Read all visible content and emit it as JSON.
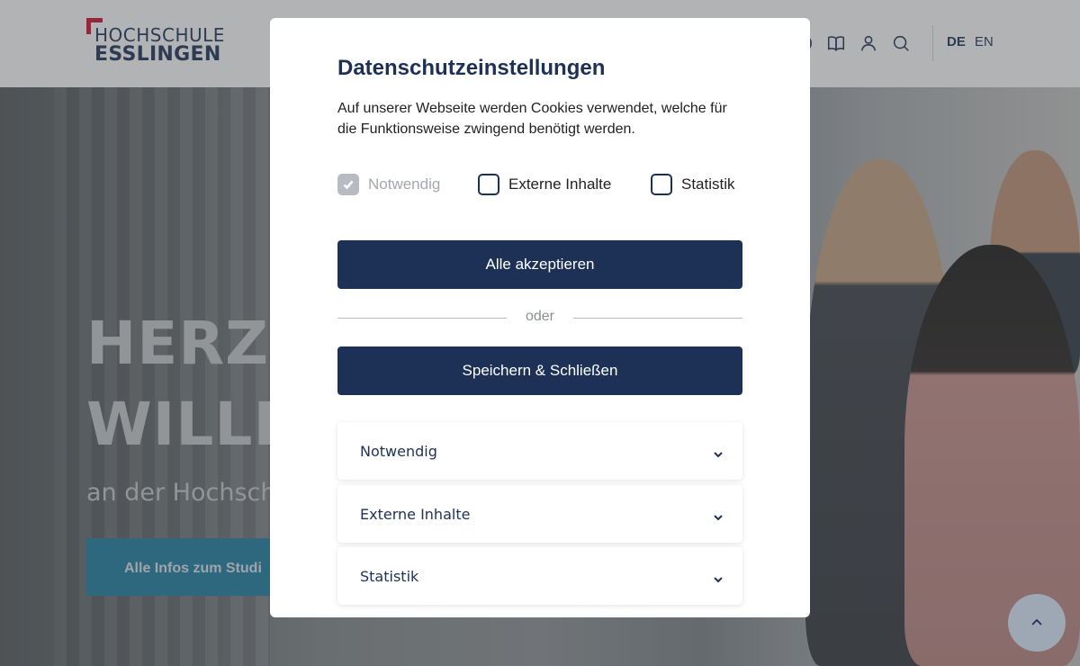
{
  "header": {
    "logo_line1": "HOCHSCHULE",
    "logo_line2": "ESSLINGEN",
    "icons": [
      "globe-icon",
      "book-icon",
      "user-icon",
      "search-icon"
    ],
    "languages": {
      "active": "DE",
      "other": "EN"
    }
  },
  "hero": {
    "title_line1": "HERZL",
    "title_line2": "WILLK",
    "subtitle": "an der Hochsch",
    "cta_label": "Alle Infos zum Studi"
  },
  "cookie_dialog": {
    "title": "Datenschutzeinstellungen",
    "description": "Auf unserer Webseite werden Cookies verwendet, welche für die Funktionsweise zwingend benötigt werden.",
    "checkboxes": [
      {
        "label": "Notwendig",
        "checked": true,
        "disabled": true
      },
      {
        "label": "Externe Inhalte",
        "checked": false,
        "disabled": false
      },
      {
        "label": "Statistik",
        "checked": false,
        "disabled": false
      }
    ],
    "accept_all_label": "Alle akzeptieren",
    "or_label": "oder",
    "save_close_label": "Speichern & Schließen",
    "accordion": [
      {
        "label": "Notwendig"
      },
      {
        "label": "Externe Inhalte"
      },
      {
        "label": "Statistik"
      }
    ]
  },
  "colors": {
    "brand_navy": "#1d3157",
    "brand_red": "#c8102e",
    "cta_blue": "#1e7fa0"
  }
}
